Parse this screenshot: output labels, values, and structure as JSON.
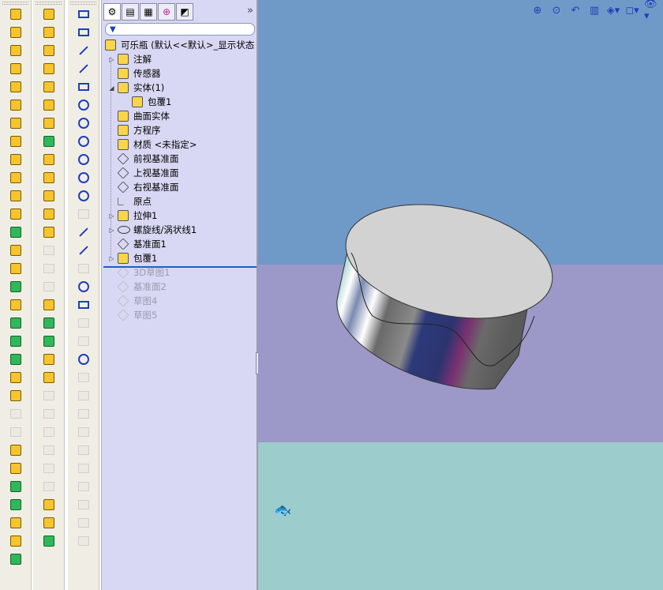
{
  "feature_manager": {
    "tabs": [
      "feature-manager-tab",
      "property-manager-tab",
      "configuration-manager-tab",
      "dimxpert-tab",
      "display-manager-tab"
    ],
    "expand_glyph": "»",
    "filter_icon": "filter-icon",
    "tree": [
      {
        "label": "可乐瓶 (默认<<默认>_显示状态",
        "icon": "part-icon",
        "expander": "",
        "level": 0,
        "rolled": false
      },
      {
        "label": "注解",
        "icon": "annotation-icon",
        "expander": "▷",
        "level": 1,
        "rolled": false
      },
      {
        "label": "传感器",
        "icon": "sensor-icon",
        "expander": "",
        "level": 1,
        "rolled": false
      },
      {
        "label": "实体(1)",
        "icon": "solid-bodies-icon",
        "expander": "◢",
        "level": 1,
        "rolled": false
      },
      {
        "label": "包覆1",
        "icon": "solid-body-icon",
        "expander": "",
        "level": 2,
        "rolled": false
      },
      {
        "label": "曲面实体",
        "icon": "surface-bodies-icon",
        "expander": "",
        "level": 1,
        "rolled": false
      },
      {
        "label": "方程序",
        "icon": "equations-icon",
        "expander": "",
        "level": 1,
        "rolled": false
      },
      {
        "label": "材质 <未指定>",
        "icon": "material-icon",
        "expander": "",
        "level": 1,
        "rolled": false
      },
      {
        "label": "前视基准面",
        "icon": "plane-icon",
        "expander": "",
        "level": 1,
        "rolled": false
      },
      {
        "label": "上视基准面",
        "icon": "plane-icon",
        "expander": "",
        "level": 1,
        "rolled": false
      },
      {
        "label": "右视基准面",
        "icon": "plane-icon",
        "expander": "",
        "level": 1,
        "rolled": false
      },
      {
        "label": "原点",
        "icon": "origin-icon",
        "expander": "",
        "level": 1,
        "rolled": false
      },
      {
        "label": "拉伸1",
        "icon": "extrude-icon",
        "expander": "▷",
        "level": 1,
        "rolled": false
      },
      {
        "label": "螺旋线/涡状线1",
        "icon": "helix-icon",
        "expander": "▷",
        "level": 1,
        "rolled": false
      },
      {
        "label": "基准面1",
        "icon": "plane-icon",
        "expander": "",
        "level": 1,
        "rolled": false
      },
      {
        "label": "包覆1",
        "icon": "wrap-icon",
        "expander": "▷",
        "level": 1,
        "rolled": false
      },
      {
        "label": "3D草图1",
        "icon": "3d-sketch-icon",
        "expander": "",
        "level": 1,
        "rolled": true
      },
      {
        "label": "基准面2",
        "icon": "plane-icon",
        "expander": "",
        "level": 1,
        "rolled": true
      },
      {
        "label": "草图4",
        "icon": "sketch-icon",
        "expander": "",
        "level": 1,
        "rolled": true
      },
      {
        "label": "草图5",
        "icon": "sketch-icon",
        "expander": "",
        "level": 1,
        "rolled": true
      }
    ]
  },
  "view_toolbar": {
    "buttons": [
      "zoom-to-fit-icon",
      "zoom-area-icon",
      "previous-view-icon",
      "section-view-icon",
      "view-orientation-icon",
      "display-style-icon",
      "hide-show-items-icon"
    ]
  },
  "viewport": {
    "background_colors": [
      "#6f9ac8",
      "#9c98c8",
      "#9ccccc"
    ],
    "model": "cylinder-cap-with-wrap-feature",
    "triad": "coordinate-triad-icon"
  },
  "colors": {
    "panel_bg": "#d8d8f4",
    "rollback_bar": "#2060c0",
    "icon_yellow": "#f6c42c"
  }
}
